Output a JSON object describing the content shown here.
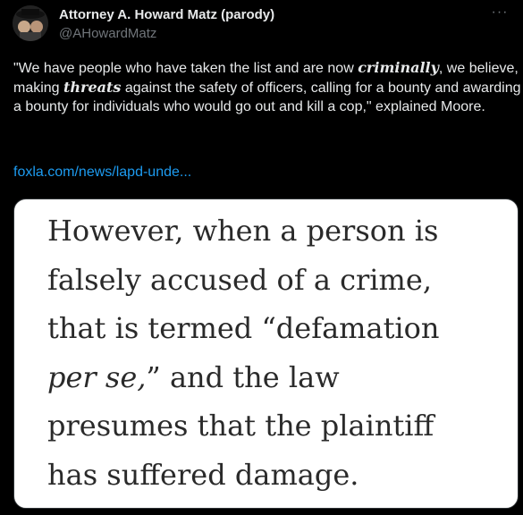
{
  "author": {
    "name": "Attorney A. Howard Matz (parody)",
    "handle": "@AHowardMatz"
  },
  "menu": {
    "more_label": "···"
  },
  "tweet": {
    "text_part1": "\"We have people who have taken the list and are now ",
    "emph1": "criminally",
    "text_part2": ", we believe, making ",
    "emph2": "threats",
    "text_part3": " against the safety of officers, calling for a bounty and awarding a bounty for individuals who would go out and kill a cop,\" explained Moore.",
    "link": "foxla.com/news/lapd-unde..."
  },
  "media": {
    "lines": [
      "However, when a person is",
      "falsely accused of a crime,",
      "that is termed “defamation",
      "per se,",
      "” and the law",
      "presumes that the plaintiff",
      "has suffered damage."
    ]
  },
  "icons": {
    "avatar": "avatar-image",
    "more": "more-options-icon"
  }
}
